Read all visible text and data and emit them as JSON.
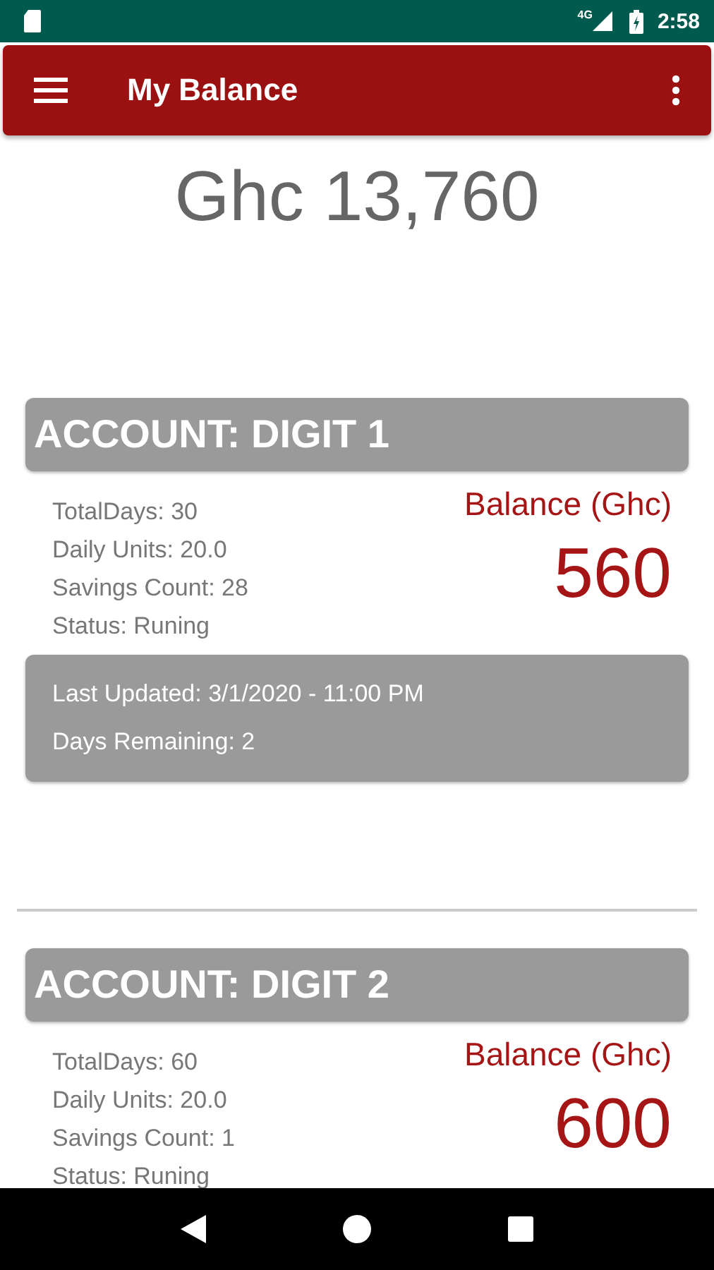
{
  "status_bar": {
    "time": "2:58",
    "network": "4G"
  },
  "app_bar": {
    "title": "My Balance"
  },
  "total": "Ghc 13,760",
  "accounts": [
    {
      "title": "ACCOUNT: DIGIT 1",
      "details": [
        "TotalDays: 30",
        "Daily Units: 20.0",
        "Savings Count: 28",
        "Status: Runing"
      ],
      "balance_label": "Balance (Ghc)",
      "balance": "560",
      "info": [
        "Last Updated: 3/1/2020 - 11:00 PM",
        "Days Remaining: 2"
      ]
    },
    {
      "title": "ACCOUNT: DIGIT 2",
      "details": [
        "TotalDays: 60",
        "Daily Units: 20.0",
        "Savings Count: 1",
        "Status: Runing"
      ],
      "balance_label": "Balance (Ghc)",
      "balance": "600"
    }
  ]
}
